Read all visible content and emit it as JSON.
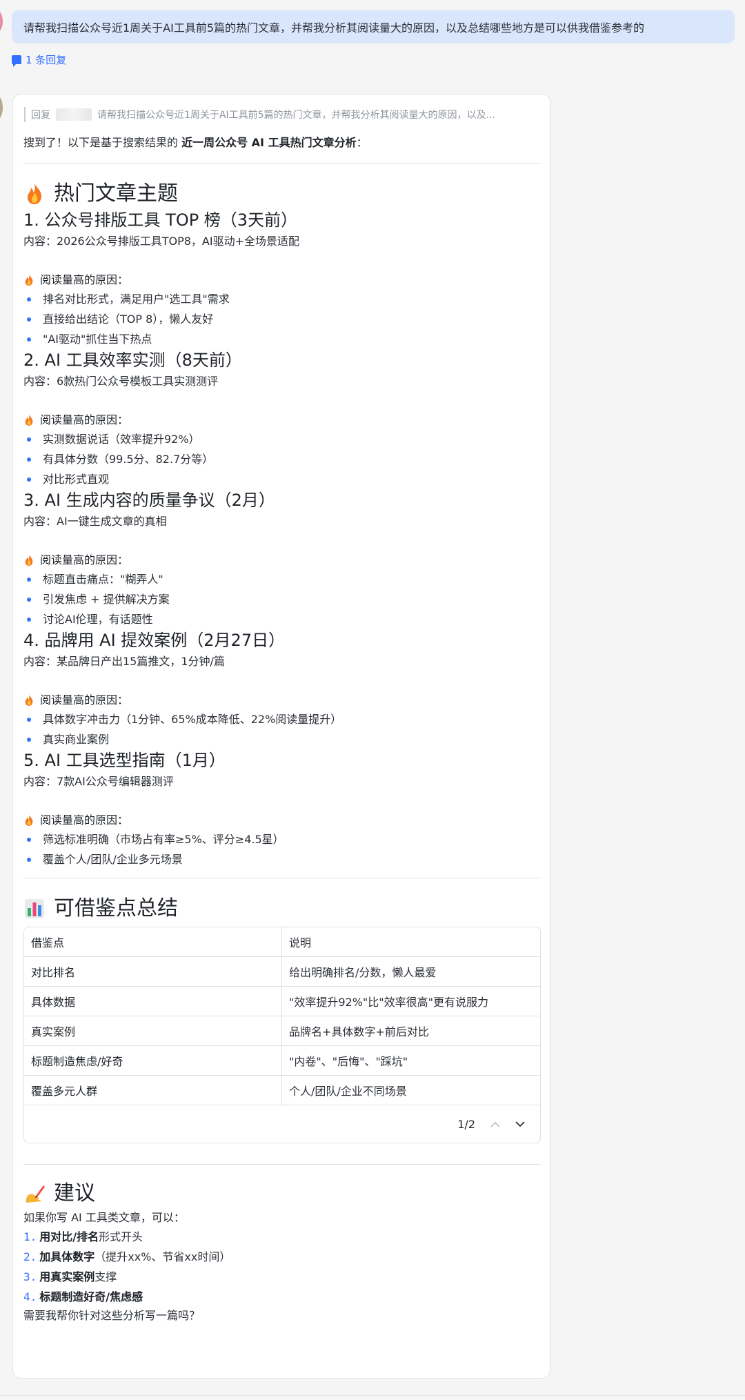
{
  "prompt": {
    "text": "请帮我扫描公众号近1周关于AI工具前5篇的热门文章，并帮我分析其阅读量大的原因，以及总结哪些地方是可以供我借鉴参考的"
  },
  "thread": {
    "reply_count_label": "1 条回复"
  },
  "quote": {
    "prefix": "回复",
    "text": "请帮我扫描公众号近1周关于AI工具前5篇的热门文章，并帮我分析其阅读量大的原因，以及..."
  },
  "intro": {
    "lead": "搜到了！以下是基于搜索结果的 ",
    "bold": "近一周公众号 AI 工具热门文章分析",
    "tail": "："
  },
  "section_hot": {
    "title": "热门文章主题",
    "icon": "fire-icon"
  },
  "reason_label": "阅读量高的原因：",
  "articles": [
    {
      "title": "1. 公众号排版工具 TOP 榜（3天前）",
      "content": "内容：2026公众号排版工具TOP8，AI驱动+全场景适配",
      "reasons": [
        "排名对比形式，满足用户\"选工具\"需求",
        "直接给出结论（TOP 8），懒人友好",
        "\"AI驱动\"抓住当下热点"
      ]
    },
    {
      "title": "2. AI 工具效率实测（8天前）",
      "content": "内容：6款热门公众号模板工具实测测评",
      "reasons": [
        "实测数据说话（效率提升92%）",
        "有具体分数（99.5分、82.7分等）",
        "对比形式直观"
      ]
    },
    {
      "title": "3. AI 生成内容的质量争议（2月）",
      "content": "内容：AI一键生成文章的真相",
      "reasons": [
        "标题直击痛点：\"糊弄人\"",
        "引发焦虑 + 提供解决方案",
        "讨论AI伦理，有话题性"
      ]
    },
    {
      "title": "4. 品牌用 AI 提效案例（2月27日）",
      "content": "内容：某品牌日产出15篇推文，1分钟/篇",
      "reasons": [
        "具体数字冲击力（1分钟、65%成本降低、22%阅读量提升）",
        "真实商业案例"
      ]
    },
    {
      "title": "5. AI 工具选型指南（1月）",
      "content": "内容：7款AI公众号编辑器测评",
      "reasons": [
        "筛选标准明确（市场占有率≥5%、评分≥4.5星）",
        "覆盖个人/团队/企业多元场景"
      ]
    }
  ],
  "section_summary": {
    "title": "可借鉴点总结",
    "icon": "bar-chart-icon"
  },
  "table": {
    "headers": [
      "借鉴点",
      "说明"
    ],
    "rows": [
      [
        "对比排名",
        "给出明确排名/分数，懒人最爱"
      ],
      [
        "具体数据",
        "\"效率提升92%\"比\"效率很高\"更有说服力"
      ],
      [
        "真实案例",
        "品牌名+具体数字+前后对比"
      ],
      [
        "标题制造焦虑/好奇",
        "\"内卷\"、\"后悔\"、\"踩坑\""
      ],
      [
        "覆盖多元人群",
        "个人/团队/企业不同场景"
      ]
    ],
    "page_label": "1/2"
  },
  "section_advice": {
    "title": "建议",
    "icon": "writing-hand-icon",
    "lead": "如果你写 AI 工具类文章，可以：",
    "items": [
      {
        "n": "1.",
        "bold": "用对比/排名",
        "rest": "形式开头"
      },
      {
        "n": "2.",
        "bold": "加具体数字",
        "rest": "（提升xx%、节省xx时间）"
      },
      {
        "n": "3.",
        "bold": "用真实案例",
        "rest": "支撑"
      },
      {
        "n": "4.",
        "bold": "标题制造好奇/焦虑感",
        "rest": ""
      }
    ],
    "closing": "需要我帮你针对这些分析写一篇吗？"
  }
}
